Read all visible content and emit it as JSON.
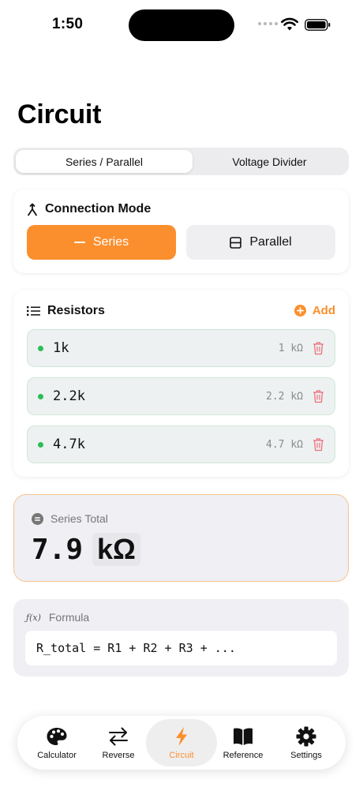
{
  "status": {
    "time": "1:50"
  },
  "page": {
    "title": "Circuit"
  },
  "segments": [
    {
      "label": "Series / Parallel",
      "active": true
    },
    {
      "label": "Voltage Divider",
      "active": false
    }
  ],
  "connection": {
    "title": "Connection Mode",
    "icon": "merge-icon",
    "options": [
      {
        "label": "Series",
        "icon": "minus-icon",
        "selected": true
      },
      {
        "label": "Parallel",
        "icon": "split-square-icon",
        "selected": false
      }
    ]
  },
  "resistors": {
    "title": "Resistors",
    "icon": "list-icon",
    "add_label": "Add",
    "items": [
      {
        "name": "1k",
        "value": "1 kΩ"
      },
      {
        "name": "2.2k",
        "value": "2.2 kΩ"
      },
      {
        "name": "4.7k",
        "value": "4.7 kΩ"
      }
    ]
  },
  "total": {
    "label": "Series Total",
    "value": "7.9",
    "unit": "kΩ"
  },
  "formula": {
    "label": "Formula",
    "icon_text": "ƒ(x)",
    "text": "R_total = R1 + R2 + R3 + ..."
  },
  "tabs": [
    {
      "label": "Calculator",
      "icon": "palette-icon",
      "active": false
    },
    {
      "label": "Reverse",
      "icon": "swap-arrows-icon",
      "active": false
    },
    {
      "label": "Circuit",
      "icon": "bolt-icon",
      "active": true
    },
    {
      "label": "Reference",
      "icon": "book-icon",
      "active": false
    },
    {
      "label": "Settings",
      "icon": "gear-icon",
      "active": false
    }
  ],
  "colors": {
    "accent": "#fb8f2d",
    "active_dot": "#2dbd59",
    "delete": "#e8707a"
  }
}
